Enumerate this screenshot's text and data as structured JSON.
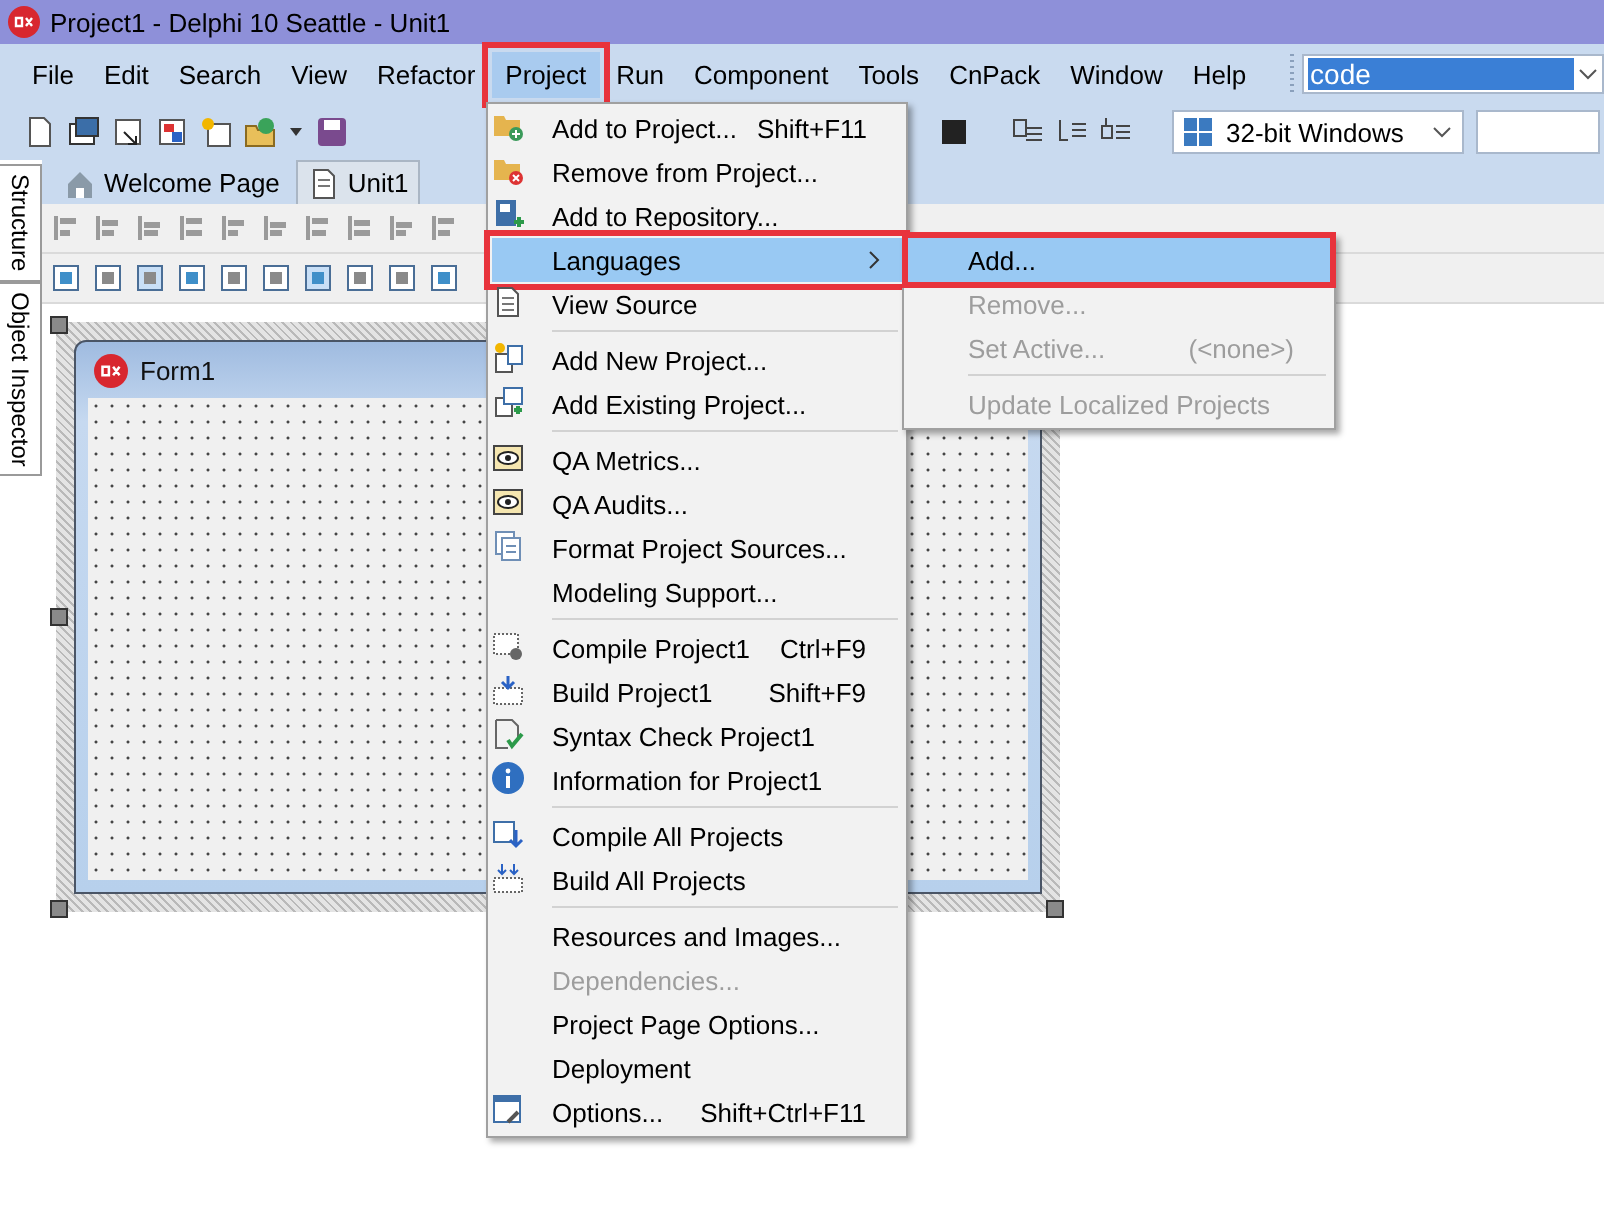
{
  "window": {
    "title": "Project1 - Delphi 10 Seattle - Unit1"
  },
  "menu_bar": [
    {
      "label": "File",
      "selected": false,
      "highlighted": false
    },
    {
      "label": "Edit",
      "selected": false,
      "highlighted": false
    },
    {
      "label": "Search",
      "selected": false,
      "highlighted": false
    },
    {
      "label": "View",
      "selected": false,
      "highlighted": false
    },
    {
      "label": "Refactor",
      "selected": false,
      "highlighted": false
    },
    {
      "label": "Project",
      "selected": true,
      "highlighted": true
    },
    {
      "label": "Run",
      "selected": false,
      "highlighted": false
    },
    {
      "label": "Component",
      "selected": false,
      "highlighted": false
    },
    {
      "label": "Tools",
      "selected": false,
      "highlighted": false
    },
    {
      "label": "CnPack",
      "selected": false,
      "highlighted": false
    },
    {
      "label": "Window",
      "selected": false,
      "highlighted": false
    },
    {
      "label": "Help",
      "selected": false,
      "highlighted": false
    }
  ],
  "search_box": {
    "value": "code",
    "text_selected": true
  },
  "platform_select": {
    "value": "32-bit Windows"
  },
  "side_tabs": [
    "Structure",
    "Object Inspector"
  ],
  "tabs": [
    {
      "label": "Welcome Page",
      "selected": false
    },
    {
      "label": "Unit1",
      "selected": true
    }
  ],
  "form": {
    "title": "Form1"
  },
  "project_menu": [
    {
      "label": "Add to Project...",
      "shortcut": "Shift+F11",
      "selected": false,
      "disabled": false,
      "highlighted": false,
      "submenu": false,
      "separator_before": false
    },
    {
      "label": "Remove from Project...",
      "selected": false,
      "disabled": false,
      "highlighted": false,
      "submenu": false,
      "separator_before": false
    },
    {
      "label": "Add to Repository...",
      "selected": false,
      "disabled": false,
      "highlighted": false,
      "submenu": false,
      "separator_before": false
    },
    {
      "label": "Languages",
      "selected": true,
      "disabled": false,
      "highlighted": true,
      "submenu": true,
      "separator_before": false
    },
    {
      "label": "View Source",
      "selected": false,
      "disabled": false,
      "highlighted": false,
      "submenu": false,
      "separator_before": false
    },
    {
      "label": "Add New Project...",
      "selected": false,
      "disabled": false,
      "highlighted": false,
      "submenu": false,
      "separator_before": true
    },
    {
      "label": "Add Existing Project...",
      "selected": false,
      "disabled": false,
      "highlighted": false,
      "submenu": false,
      "separator_before": false
    },
    {
      "label": "QA Metrics...",
      "selected": false,
      "disabled": false,
      "highlighted": false,
      "submenu": false,
      "separator_before": true
    },
    {
      "label": "QA Audits...",
      "selected": false,
      "disabled": false,
      "highlighted": false,
      "submenu": false,
      "separator_before": false
    },
    {
      "label": "Format Project Sources...",
      "selected": false,
      "disabled": false,
      "highlighted": false,
      "submenu": false,
      "separator_before": false
    },
    {
      "label": "Modeling Support...",
      "selected": false,
      "disabled": false,
      "highlighted": false,
      "submenu": false,
      "separator_before": false
    },
    {
      "label": "Compile Project1",
      "shortcut": "Ctrl+F9",
      "selected": false,
      "disabled": false,
      "highlighted": false,
      "submenu": false,
      "separator_before": true
    },
    {
      "label": "Build Project1",
      "shortcut": "Shift+F9",
      "selected": false,
      "disabled": false,
      "highlighted": false,
      "submenu": false,
      "separator_before": false
    },
    {
      "label": "Syntax Check Project1",
      "selected": false,
      "disabled": false,
      "highlighted": false,
      "submenu": false,
      "separator_before": false
    },
    {
      "label": "Information for Project1",
      "selected": false,
      "disabled": false,
      "highlighted": false,
      "submenu": false,
      "separator_before": false
    },
    {
      "label": "Compile All Projects",
      "selected": false,
      "disabled": false,
      "highlighted": false,
      "submenu": false,
      "separator_before": true
    },
    {
      "label": "Build All Projects",
      "selected": false,
      "disabled": false,
      "highlighted": false,
      "submenu": false,
      "separator_before": false
    },
    {
      "label": "Resources and Images...",
      "selected": false,
      "disabled": false,
      "highlighted": false,
      "submenu": false,
      "separator_before": true
    },
    {
      "label": "Dependencies...",
      "selected": false,
      "disabled": true,
      "highlighted": false,
      "submenu": false,
      "separator_before": false
    },
    {
      "label": "Project Page Options...",
      "selected": false,
      "disabled": false,
      "highlighted": false,
      "submenu": false,
      "separator_before": false
    },
    {
      "label": "Deployment",
      "selected": false,
      "disabled": false,
      "highlighted": false,
      "submenu": false,
      "separator_before": false
    },
    {
      "label": "Options...",
      "shortcut": "Shift+Ctrl+F11",
      "selected": false,
      "disabled": false,
      "highlighted": false,
      "submenu": false,
      "separator_before": false
    }
  ],
  "languages_submenu": [
    {
      "label": "Add...",
      "selected": true,
      "disabled": false,
      "highlighted": true,
      "separator_before": false
    },
    {
      "label": "Remove...",
      "selected": false,
      "disabled": true,
      "highlighted": false,
      "separator_before": false
    },
    {
      "label": "Set Active...",
      "shortcut": "(<none>)",
      "selected": false,
      "disabled": true,
      "highlighted": false,
      "separator_before": false
    },
    {
      "label": "Update Localized Projects",
      "selected": false,
      "disabled": true,
      "highlighted": false,
      "separator_before": true
    }
  ]
}
